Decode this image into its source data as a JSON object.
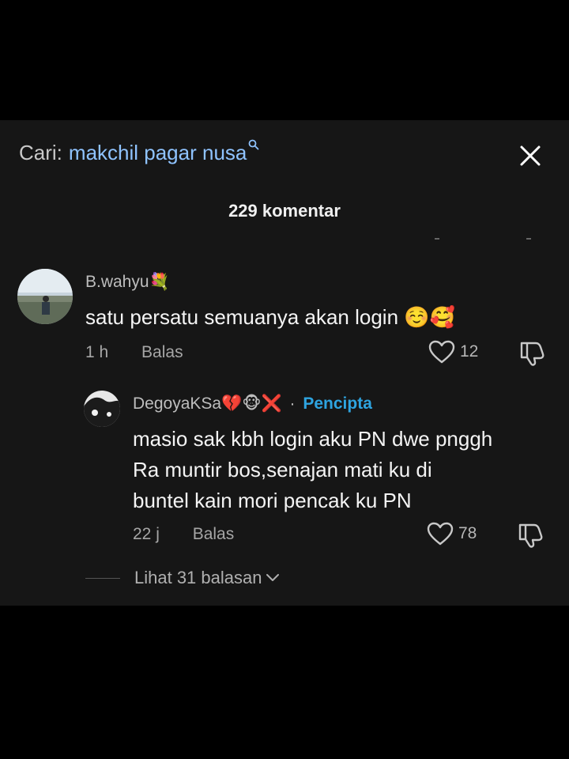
{
  "search": {
    "prefix": "Cari:",
    "query": "makchil pagar nusa"
  },
  "header": {
    "comment_count": "229 komentar"
  },
  "comments": [
    {
      "username": "B.wahyu",
      "username_emoji": "💐",
      "text": "satu persatu semuanya akan login",
      "text_emoji": "☺️🥰",
      "time": "1 h",
      "reply_label": "Balas",
      "likes": "12"
    }
  ],
  "reply": {
    "username": "DegoyaKSa",
    "username_emoji": "💔🐵❌",
    "separator": "·",
    "badge": "Pencipta",
    "text_lines": [
      "masio sak kbh login aku PN dwe pnggh",
      "Ra muntir bos,senajan mati ku di",
      "buntel kain mori pencak ku PN"
    ],
    "time": "22 j",
    "reply_label": "Balas",
    "likes": "78"
  },
  "view_replies": {
    "label": "Lihat 31 balasan"
  },
  "icons": {
    "close": "close-icon",
    "search": "search-icon",
    "heart": "heart-icon",
    "dislike": "dislike-icon",
    "chevron": "chevron-down-icon"
  },
  "colors": {
    "panel_bg": "#161616",
    "query": "#8fc3ff",
    "creator_badge": "#2ea4e0"
  }
}
